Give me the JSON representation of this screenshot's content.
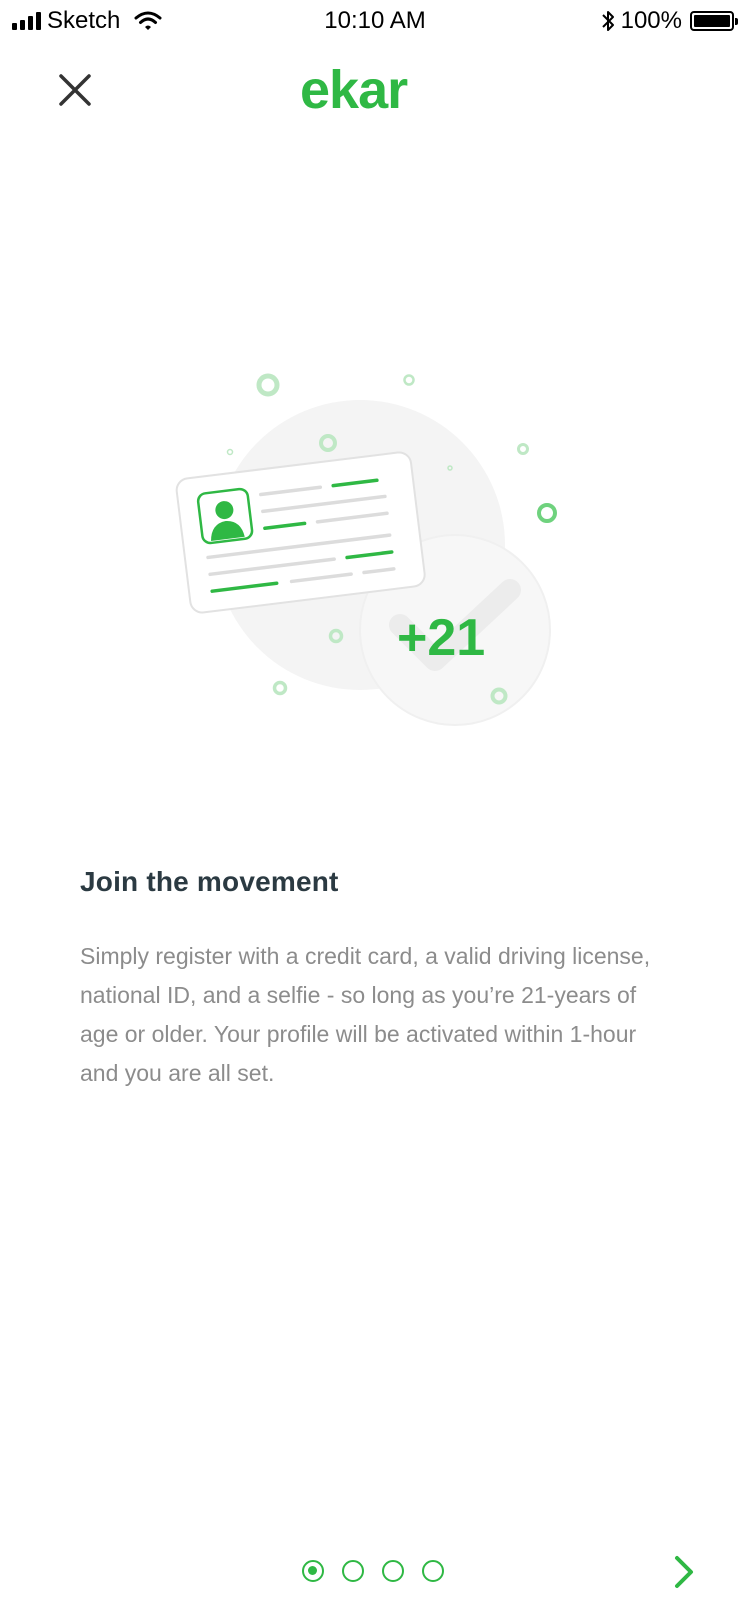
{
  "status_bar": {
    "carrier": "Sketch",
    "time": "10:10 AM",
    "battery": "100%"
  },
  "header": {
    "logo_text": "ekar",
    "close_icon": "close-icon"
  },
  "illustration": {
    "badge_text": "+21",
    "icon": "id-card-icon"
  },
  "content": {
    "title": "Join the movement",
    "body": "Simply register with a credit card, a valid driving license, national ID, and a selfie - so long as you’re 21-years of age or older. Your profile will be activated within 1-hour and you are all set."
  },
  "pager": {
    "total_pages": 4,
    "current_page": 1,
    "next_icon": "chevron-right-icon"
  },
  "colors": {
    "brand_green": "#2fb844",
    "title": "#2b3a42",
    "body": "#8c8c8c"
  }
}
